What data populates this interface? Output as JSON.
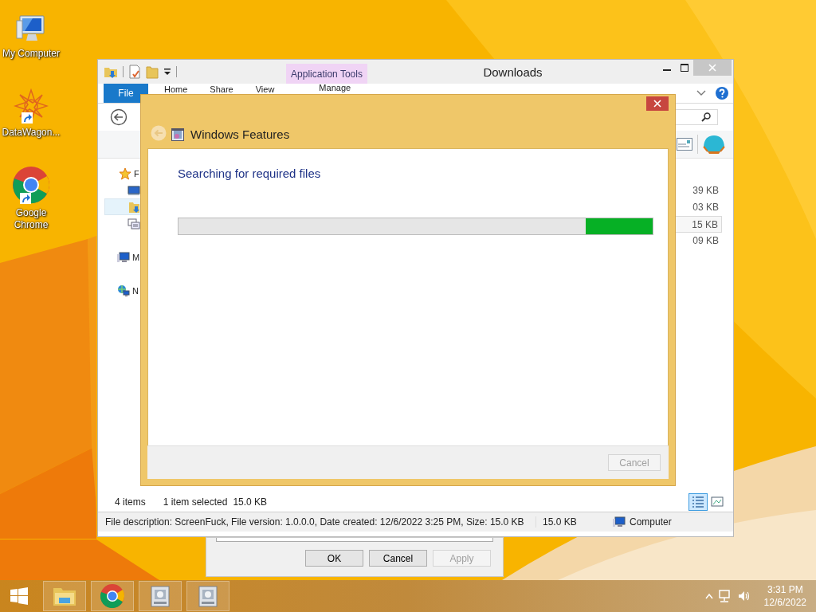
{
  "desktop_icons": [
    {
      "label": "My Computer",
      "kind": "computer"
    },
    {
      "label": "DataWagon...",
      "kind": "mandala"
    },
    {
      "label": "Google Chrome",
      "kind": "chrome"
    }
  ],
  "explorer": {
    "title": "Downloads",
    "context_tab": "Application Tools",
    "ribbon_tabs": [
      {
        "label": "File",
        "kind": "file"
      },
      {
        "label": "Home",
        "kind": "tab"
      },
      {
        "label": "Share",
        "kind": "tab"
      },
      {
        "label": "View",
        "kind": "tab"
      },
      {
        "label": "Manage",
        "kind": "tab"
      }
    ],
    "nav_tree": [
      {
        "label": "F",
        "kind": "favorites",
        "selected": false,
        "children": [
          {
            "kind": "desktop",
            "selected": false
          },
          {
            "kind": "downloads",
            "selected": true
          },
          {
            "kind": "recent",
            "selected": false
          }
        ]
      },
      {
        "label": "M",
        "kind": "computer",
        "selected": false
      },
      {
        "label": "N",
        "kind": "network",
        "selected": false
      }
    ],
    "file_sizes": [
      {
        "size": "39 KB",
        "selected": false
      },
      {
        "size": "03 KB",
        "selected": false
      },
      {
        "size": "15 KB",
        "selected": true
      },
      {
        "size": "09 KB",
        "selected": false
      }
    ],
    "item_count": "4 items",
    "selection": "1 item selected",
    "selection_size": "15.0 KB",
    "view_buttons": [
      {
        "kind": "details",
        "selected": true
      },
      {
        "kind": "large-icons",
        "selected": false
      }
    ],
    "details": {
      "description": "File description: ScreenFuck, File version: 1.0.0.0, Date created: 12/6/2022 3:25 PM, Size: 15.0 KB",
      "size": "15.0 KB",
      "zone": "Computer"
    }
  },
  "properties_dialog": {
    "buttons": [
      {
        "label": "OK",
        "disabled": false
      },
      {
        "label": "Cancel",
        "disabled": false
      },
      {
        "label": "Apply",
        "disabled": true
      }
    ]
  },
  "features_dialog": {
    "title": "Windows Features",
    "heading": "Searching for required files",
    "progress": {
      "kind": "marquee"
    },
    "buttons": [
      {
        "label": "Cancel",
        "disabled": true
      }
    ]
  },
  "taskbar": {
    "apps": [
      {
        "kind": "explorer"
      },
      {
        "kind": "chrome"
      },
      {
        "kind": "app"
      },
      {
        "kind": "app"
      }
    ],
    "time": "3:31 PM",
    "date": "12/6/2022"
  }
}
